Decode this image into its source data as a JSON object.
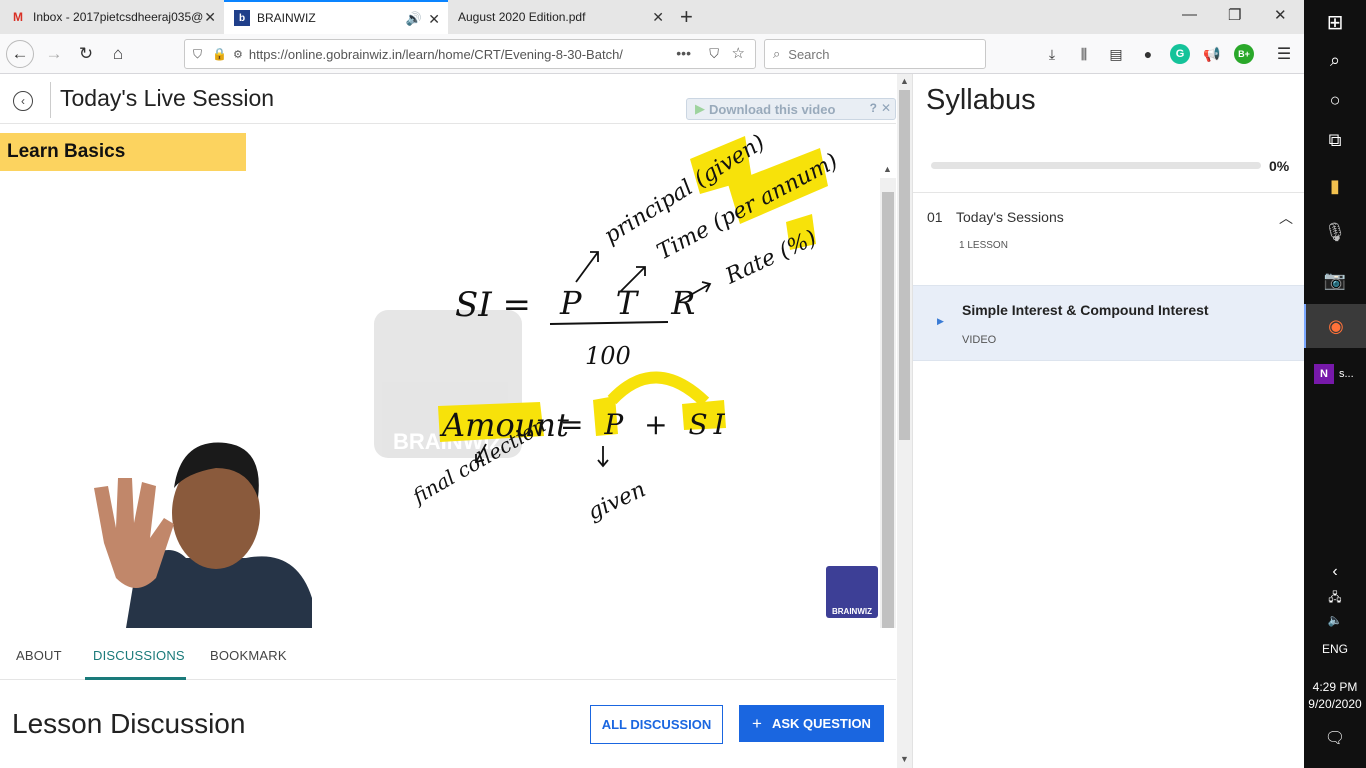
{
  "browser": {
    "tabs": [
      {
        "title": "Inbox - 2017pietcsdheeraj035@",
        "favicon": "gmail-icon"
      },
      {
        "title": "BRAINWIZ",
        "favicon": "brainwiz-icon",
        "active": true
      },
      {
        "title": "August 2020 Edition.pdf",
        "favicon": ""
      }
    ],
    "url": "https://online.gobrainwiz.in/learn/home/CRT/Evening-8-30-Batch/",
    "url_domain": "gobrainwiz.in",
    "search_placeholder": "Search"
  },
  "page": {
    "session_title": "Today's Live Session",
    "download_label": "Download this video",
    "video": {
      "banner": "Learn Basics",
      "watermark": "BRAINWIZ",
      "corner_logo": "BRAINWIZ",
      "whiteboard": {
        "formula_lhs": "SI =",
        "formula_num": "P T R",
        "formula_den": "100",
        "principal_label": "principal (given)",
        "time_label": "Time (per annum)",
        "rate_label": "Rate (%)",
        "amount_lhs": "Amount",
        "amount_eq": "= P + SI",
        "final_label": "final collection",
        "given_label": "given"
      }
    },
    "content_tabs": [
      "ABOUT",
      "DISCUSSIONS",
      "BOOKMARK"
    ],
    "active_content_tab": "DISCUSSIONS",
    "discussion_title": "Lesson Discussion",
    "all_discussion_label": "ALL DISCUSSION",
    "ask_question_label": "ASK QUESTION"
  },
  "syllabus": {
    "title": "Syllabus",
    "progress_percent": 0,
    "progress_label": "0%",
    "sections": [
      {
        "number": "01",
        "title": "Today's Sessions",
        "count_label": "1 LESSON",
        "lessons": [
          {
            "title": "Simple Interest & Compound Interest",
            "type": "VIDEO"
          }
        ]
      }
    ]
  },
  "taskbar": {
    "onenote_label": "s...",
    "language": "ENG",
    "time": "4:29 PM",
    "date": "9/20/2020"
  }
}
